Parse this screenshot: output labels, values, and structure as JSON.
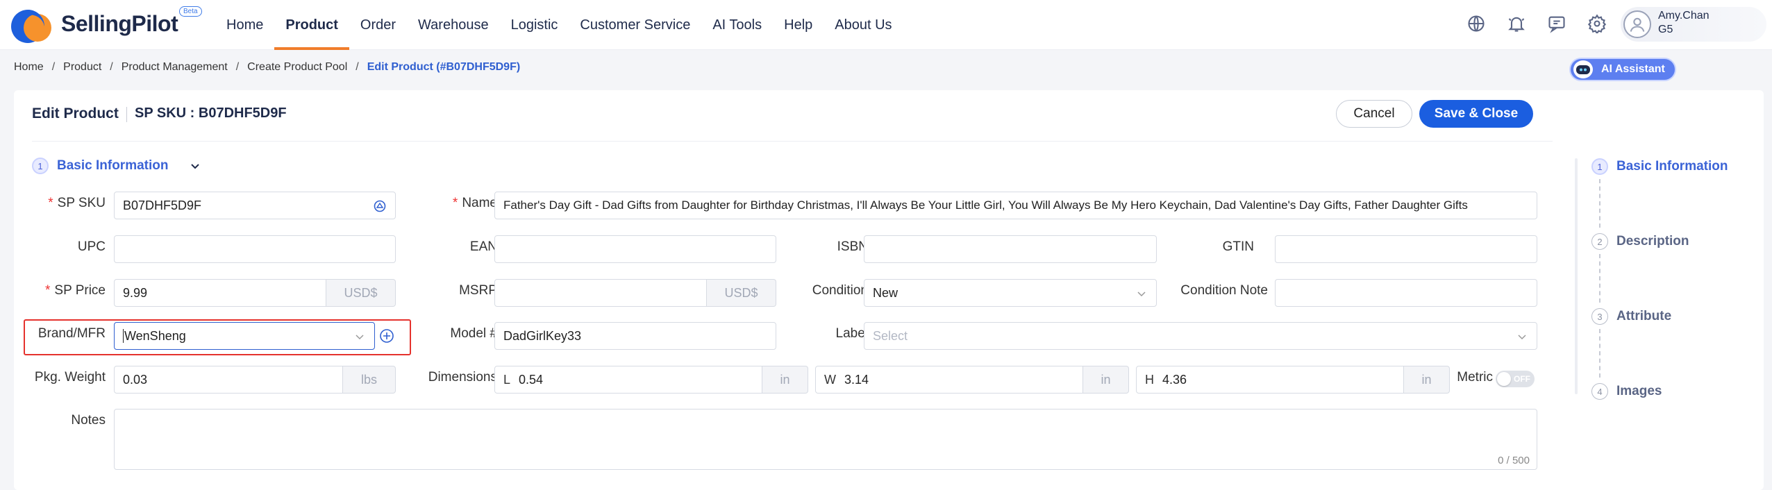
{
  "app": {
    "brand": "SellingPilot",
    "beta_badge": "Beta",
    "nav": [
      {
        "label": "Home",
        "active": false
      },
      {
        "label": "Product",
        "active": true
      },
      {
        "label": "Order",
        "active": false
      },
      {
        "label": "Warehouse",
        "active": false
      },
      {
        "label": "Logistic",
        "active": false
      },
      {
        "label": "Customer Service",
        "active": false
      },
      {
        "label": "AI Tools",
        "active": false
      },
      {
        "label": "Help",
        "active": false
      },
      {
        "label": "About Us",
        "active": false
      }
    ],
    "top_icons": [
      "globe-icon",
      "bell-icon",
      "message-icon",
      "gear-icon"
    ],
    "user": {
      "name": "Amy.Chan",
      "org": "G5"
    },
    "accent_color": "#f07d2b",
    "primary_color": "#1b5ee0"
  },
  "breadcrumb": [
    "Home",
    "Product",
    "Product Management",
    "Create Product Pool",
    "Edit Product (#B07DHF5D9F)"
  ],
  "ai_assistant_label": "AI Assistant",
  "header": {
    "title": "Edit Product",
    "sku_label": "SP SKU : B07DHF5D9F",
    "cancel_label": "Cancel",
    "save_label": "Save & Close"
  },
  "section": {
    "step": "1",
    "label": "Basic Information"
  },
  "form": {
    "sp_sku": {
      "label": "SP SKU",
      "value": "B07DHF5D9F"
    },
    "name": {
      "label": "Name",
      "value": "Father's Day Gift - Dad Gifts from Daughter for Birthday Christmas, I'll Always Be Your Little Girl, You Will Always Be My Hero Keychain, Dad Valentine's Day Gifts, Father Daughter Gifts"
    },
    "upc": {
      "label": "UPC",
      "value": ""
    },
    "ean": {
      "label": "EAN",
      "value": ""
    },
    "isbn": {
      "label": "ISBN",
      "value": ""
    },
    "gtin": {
      "label": "GTIN",
      "value": ""
    },
    "sp_price": {
      "label": "SP Price",
      "value": "9.99",
      "unit": "USD$"
    },
    "msrp": {
      "label": "MSRP",
      "value": "",
      "unit": "USD$"
    },
    "condition": {
      "label": "Condition",
      "value": "New"
    },
    "condition_note": {
      "label": "Condition Note",
      "value": ""
    },
    "brand": {
      "label": "Brand/MFR",
      "value": "WenSheng"
    },
    "model": {
      "label": "Model #",
      "value": "DadGirlKey33"
    },
    "label": {
      "label": "Label",
      "placeholder": "Select"
    },
    "pkg_weight": {
      "label": "Pkg. Weight",
      "value": "0.03",
      "unit": "lbs"
    },
    "dimensions": {
      "label": "Dimensions",
      "l": {
        "prefix": "L",
        "value": "0.54",
        "unit": "in"
      },
      "w": {
        "prefix": "W",
        "value": "3.14",
        "unit": "in"
      },
      "h": {
        "prefix": "H",
        "value": "4.36",
        "unit": "in"
      }
    },
    "metric": {
      "label": "Metric",
      "toggle_text": "OFF",
      "on": false
    },
    "notes": {
      "label": "Notes",
      "counter": "0 / 500"
    }
  },
  "steps": [
    {
      "num": "1",
      "label": "Basic Information",
      "active": true
    },
    {
      "num": "2",
      "label": "Description",
      "active": false
    },
    {
      "num": "3",
      "label": "Attribute",
      "active": false
    },
    {
      "num": "4",
      "label": "Images",
      "active": false
    }
  ]
}
